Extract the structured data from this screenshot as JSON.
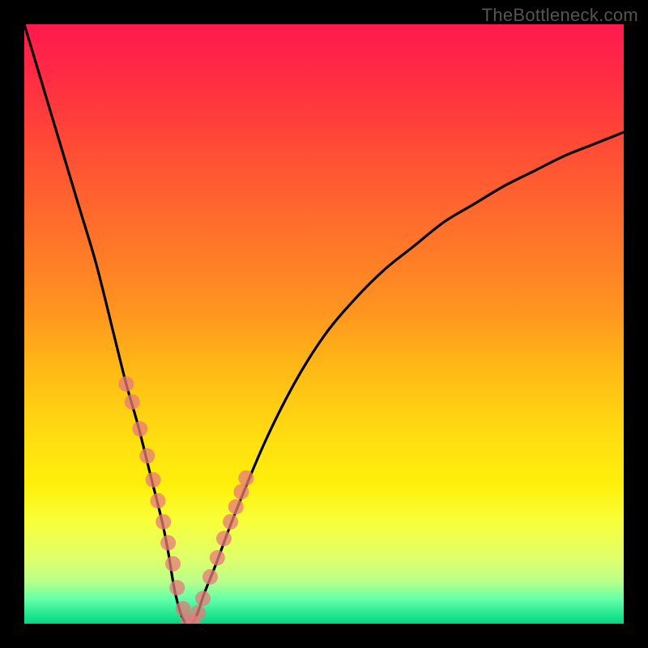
{
  "watermark": "TheBottleneck.com",
  "chart_data": {
    "type": "line",
    "title": "",
    "xlabel": "",
    "ylabel": "",
    "xlim": [
      0,
      100
    ],
    "ylim": [
      0,
      100
    ],
    "grid": false,
    "series": [
      {
        "name": "bottleneck-curve",
        "x": [
          0,
          3,
          6,
          9,
          12,
          15,
          17,
          19,
          21,
          23,
          24,
          25,
          26,
          27,
          28,
          29,
          30,
          32,
          35,
          40,
          45,
          50,
          55,
          60,
          65,
          70,
          75,
          80,
          85,
          90,
          95,
          100
        ],
        "y": [
          100,
          90,
          80,
          70,
          60,
          48,
          40,
          33,
          25,
          17,
          12,
          6,
          2,
          0,
          0,
          2,
          5,
          10,
          18,
          30,
          40,
          48,
          54,
          59,
          63,
          67,
          70,
          73,
          75.5,
          78,
          80,
          82
        ]
      }
    ],
    "markers": {
      "name": "highlight-dots",
      "x": [
        17,
        18,
        19.3,
        20.5,
        21.5,
        22.3,
        23.2,
        24.0,
        24.8,
        25.5,
        26.5,
        27.3,
        28.1,
        29.0,
        29.8,
        31.0,
        32.2,
        33.3,
        34.4,
        35.3,
        36.2,
        37.0
      ],
      "y": [
        40,
        37,
        32.5,
        28,
        24,
        20.5,
        17,
        13.5,
        10,
        6,
        2.5,
        0.5,
        0.2,
        1.8,
        4.2,
        7.8,
        11,
        14.2,
        17,
        19.5,
        22,
        24.3
      ]
    }
  }
}
